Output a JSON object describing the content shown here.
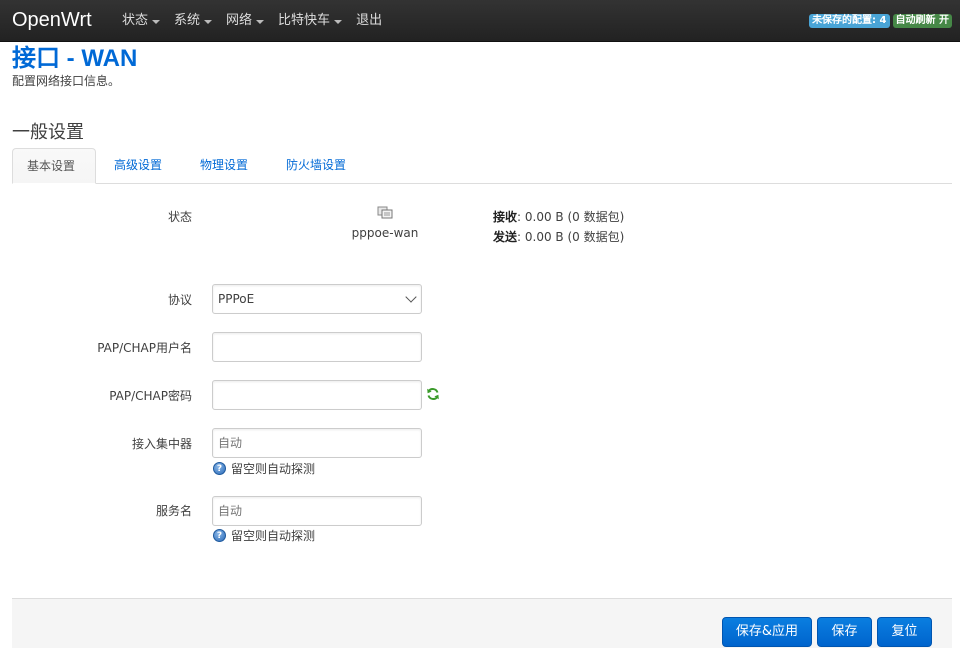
{
  "navbar": {
    "brand": "OpenWrt",
    "menu": [
      {
        "label": "状态",
        "has_caret": true
      },
      {
        "label": "系统",
        "has_caret": true
      },
      {
        "label": "网络",
        "has_caret": true
      },
      {
        "label": "比特快车",
        "has_caret": true
      },
      {
        "label": "退出",
        "has_caret": false
      }
    ],
    "unsaved_badge": "未保存的配置: 4",
    "autorefresh_badge": "自动刷新 开"
  },
  "page": {
    "title": "接口 - WAN",
    "description": "配置网络接口信息。",
    "section_title": "一般设置"
  },
  "tabs": [
    {
      "label": "基本设置",
      "active": true
    },
    {
      "label": "高级设置",
      "active": false
    },
    {
      "label": "物理设置",
      "active": false
    },
    {
      "label": "防火墙设置",
      "active": false
    }
  ],
  "status": {
    "label": "状态",
    "device": "pppoe-wan",
    "rx_label": "接收",
    "rx_value": ": 0.00 B (0 数据包)",
    "tx_label": "发送",
    "tx_value": ": 0.00 B (0 数据包)"
  },
  "form": {
    "protocol": {
      "label": "协议",
      "value": "PPPoE"
    },
    "username": {
      "label": "PAP/CHAP用户名",
      "value": ""
    },
    "password": {
      "label": "PAP/CHAP密码",
      "value": ""
    },
    "ac": {
      "label": "接入集中器",
      "placeholder": "自动",
      "hint": "留空则自动探测"
    },
    "service": {
      "label": "服务名",
      "placeholder": "自动",
      "hint": "留空则自动探测"
    }
  },
  "actions": {
    "save_apply": "保存&应用",
    "save": "保存",
    "reset": "复位"
  },
  "colors": {
    "link": "#0069d6",
    "navbar": "#222222",
    "button": "#0064cd",
    "badge_info": "#49a4d6",
    "badge_success": "#468847"
  }
}
